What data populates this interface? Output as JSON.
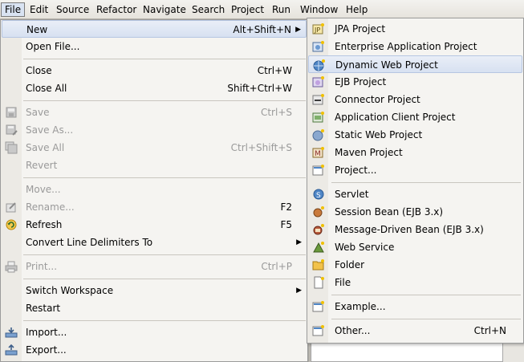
{
  "menubar": {
    "items": [
      "File",
      "Edit",
      "Source",
      "Refactor",
      "Navigate",
      "Search",
      "Project",
      "Run",
      "Window",
      "Help"
    ]
  },
  "file_menu": {
    "new": {
      "label": "New",
      "acc": "Alt+Shift+N"
    },
    "open_file": {
      "label": "Open File..."
    },
    "close": {
      "label": "Close",
      "acc": "Ctrl+W"
    },
    "close_all": {
      "label": "Close All",
      "acc": "Shift+Ctrl+W"
    },
    "save": {
      "label": "Save",
      "acc": "Ctrl+S"
    },
    "save_as": {
      "label": "Save As..."
    },
    "save_all": {
      "label": "Save All",
      "acc": "Ctrl+Shift+S"
    },
    "revert": {
      "label": "Revert"
    },
    "move": {
      "label": "Move..."
    },
    "rename": {
      "label": "Rename...",
      "acc": "F2"
    },
    "refresh": {
      "label": "Refresh",
      "acc": "F5"
    },
    "convert": {
      "label": "Convert Line Delimiters To"
    },
    "print": {
      "label": "Print...",
      "acc": "Ctrl+P"
    },
    "switch_ws": {
      "label": "Switch Workspace"
    },
    "restart": {
      "label": "Restart"
    },
    "import": {
      "label": "Import..."
    },
    "export": {
      "label": "Export..."
    }
  },
  "new_menu": {
    "jpa": "JPA Project",
    "enterprise": "Enterprise Application Project",
    "dynamic_web": "Dynamic Web Project",
    "ejb": "EJB Project",
    "connector": "Connector Project",
    "app_client": "Application Client Project",
    "static_web": "Static Web Project",
    "maven": "Maven Project",
    "project": "Project...",
    "servlet": "Servlet",
    "session_bean": "Session Bean (EJB 3.x)",
    "mdb": "Message-Driven Bean (EJB 3.x)",
    "web_service": "Web Service",
    "folder": "Folder",
    "file": "File",
    "example": "Example...",
    "other": "Other...",
    "other_acc": "Ctrl+N"
  },
  "colors": {
    "highlight": "#d7e1f1",
    "menu_bg": "#f5f4f1",
    "disabled_text": "#9a9a9a"
  }
}
